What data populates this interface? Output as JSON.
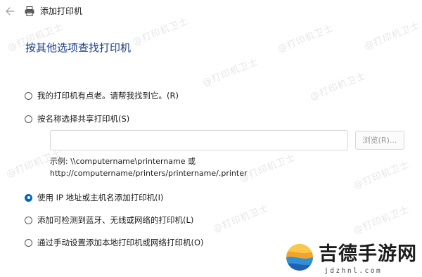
{
  "window": {
    "title": "添加打印机",
    "back_icon": "arrow-left-icon",
    "title_icon": "printer-icon"
  },
  "heading": "按其他选项查找打印机",
  "options": [
    {
      "label": "我的打印机有点老。请帮我找到它。(R)",
      "checked": false
    },
    {
      "label": "按名称选择共享打印机(S)",
      "checked": false
    },
    {
      "label": "使用 IP 地址或主机名添加打印机(I)",
      "checked": true
    },
    {
      "label": "添加可检测到蓝牙、无线或网络的打印机(L)",
      "checked": false
    },
    {
      "label": "通过手动设置添加本地打印机或网络打印机(O)",
      "checked": false
    }
  ],
  "share": {
    "input_value": "",
    "browse_label": "浏览(R)...",
    "example_line1": "示例: \\\\computername\\printername 或",
    "example_line2": "http://computername/printers/printername/.printer"
  },
  "watermark": "@打印机卫士",
  "logo": {
    "name": "吉德手游网",
    "domain": "jdzhnl.com"
  },
  "colors": {
    "heading": "#1a3f86",
    "accent": "#0067c0"
  }
}
